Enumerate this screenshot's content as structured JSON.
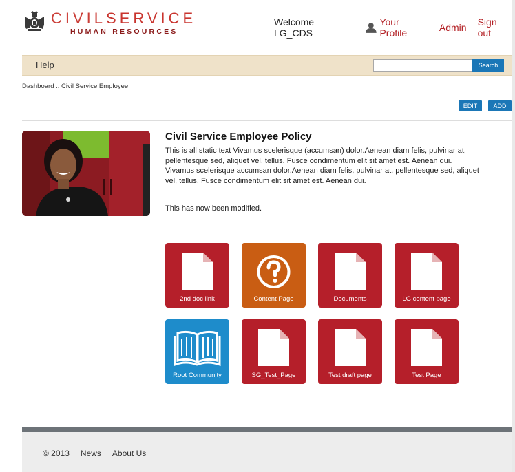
{
  "header": {
    "logo_word1": "CIVIL",
    "logo_word2": "SERVICE",
    "logo_subtitle": "HUMAN RESOURCES",
    "welcome": "Welcome LG_CDS",
    "profile_link": "Your Profile",
    "admin_link": "Admin",
    "signout_link": "Sign out"
  },
  "menubar": {
    "help_label": "Help",
    "search_value": "",
    "search_button": "Search"
  },
  "breadcrumb": "Dashboard :: Civil Service Employee",
  "actions": {
    "edit": "EDIT",
    "add": "ADD"
  },
  "policy": {
    "title": "Civil Service Employee Policy",
    "body": "This is all static text Vivamus scelerisque (accumsan) dolor.Aenean diam felis, pulvinar at, pellentesque sed, aliquet vel, tellus. Fusce condimentum elit sit amet est. Aenean dui. Vivamus scelerisque accumsan dolor.Aenean diam felis, pulvinar at, pellentesque sed, aliquet vel, tellus. Fusce condimentum elit sit amet est. Aenean dui.",
    "modified": "This  has now been modified."
  },
  "tiles": [
    {
      "label": "2nd doc link",
      "icon": "document-icon",
      "color": "#b51f2a"
    },
    {
      "label": "Content Page",
      "icon": "question-icon",
      "color": "#c95d13"
    },
    {
      "label": "Documents",
      "icon": "document-icon",
      "color": "#b51f2a"
    },
    {
      "label": "LG content page",
      "icon": "document-icon",
      "color": "#b51f2a"
    },
    {
      "label": "Root Community",
      "icon": "book-icon",
      "color": "#1e8ccb"
    },
    {
      "label": "SG_Test_Page",
      "icon": "document-icon",
      "color": "#b51f2a"
    },
    {
      "label": "Test draft page",
      "icon": "document-icon",
      "color": "#b51f2a"
    },
    {
      "label": "Test Page",
      "icon": "document-icon",
      "color": "#b51f2a"
    }
  ],
  "footer": {
    "copyright": "© 2013",
    "news": "News",
    "about": "About Us"
  },
  "colors": {
    "brand_red": "#b32025",
    "menubar_bg": "#efe2c9",
    "button_blue": "#1b77b7"
  }
}
